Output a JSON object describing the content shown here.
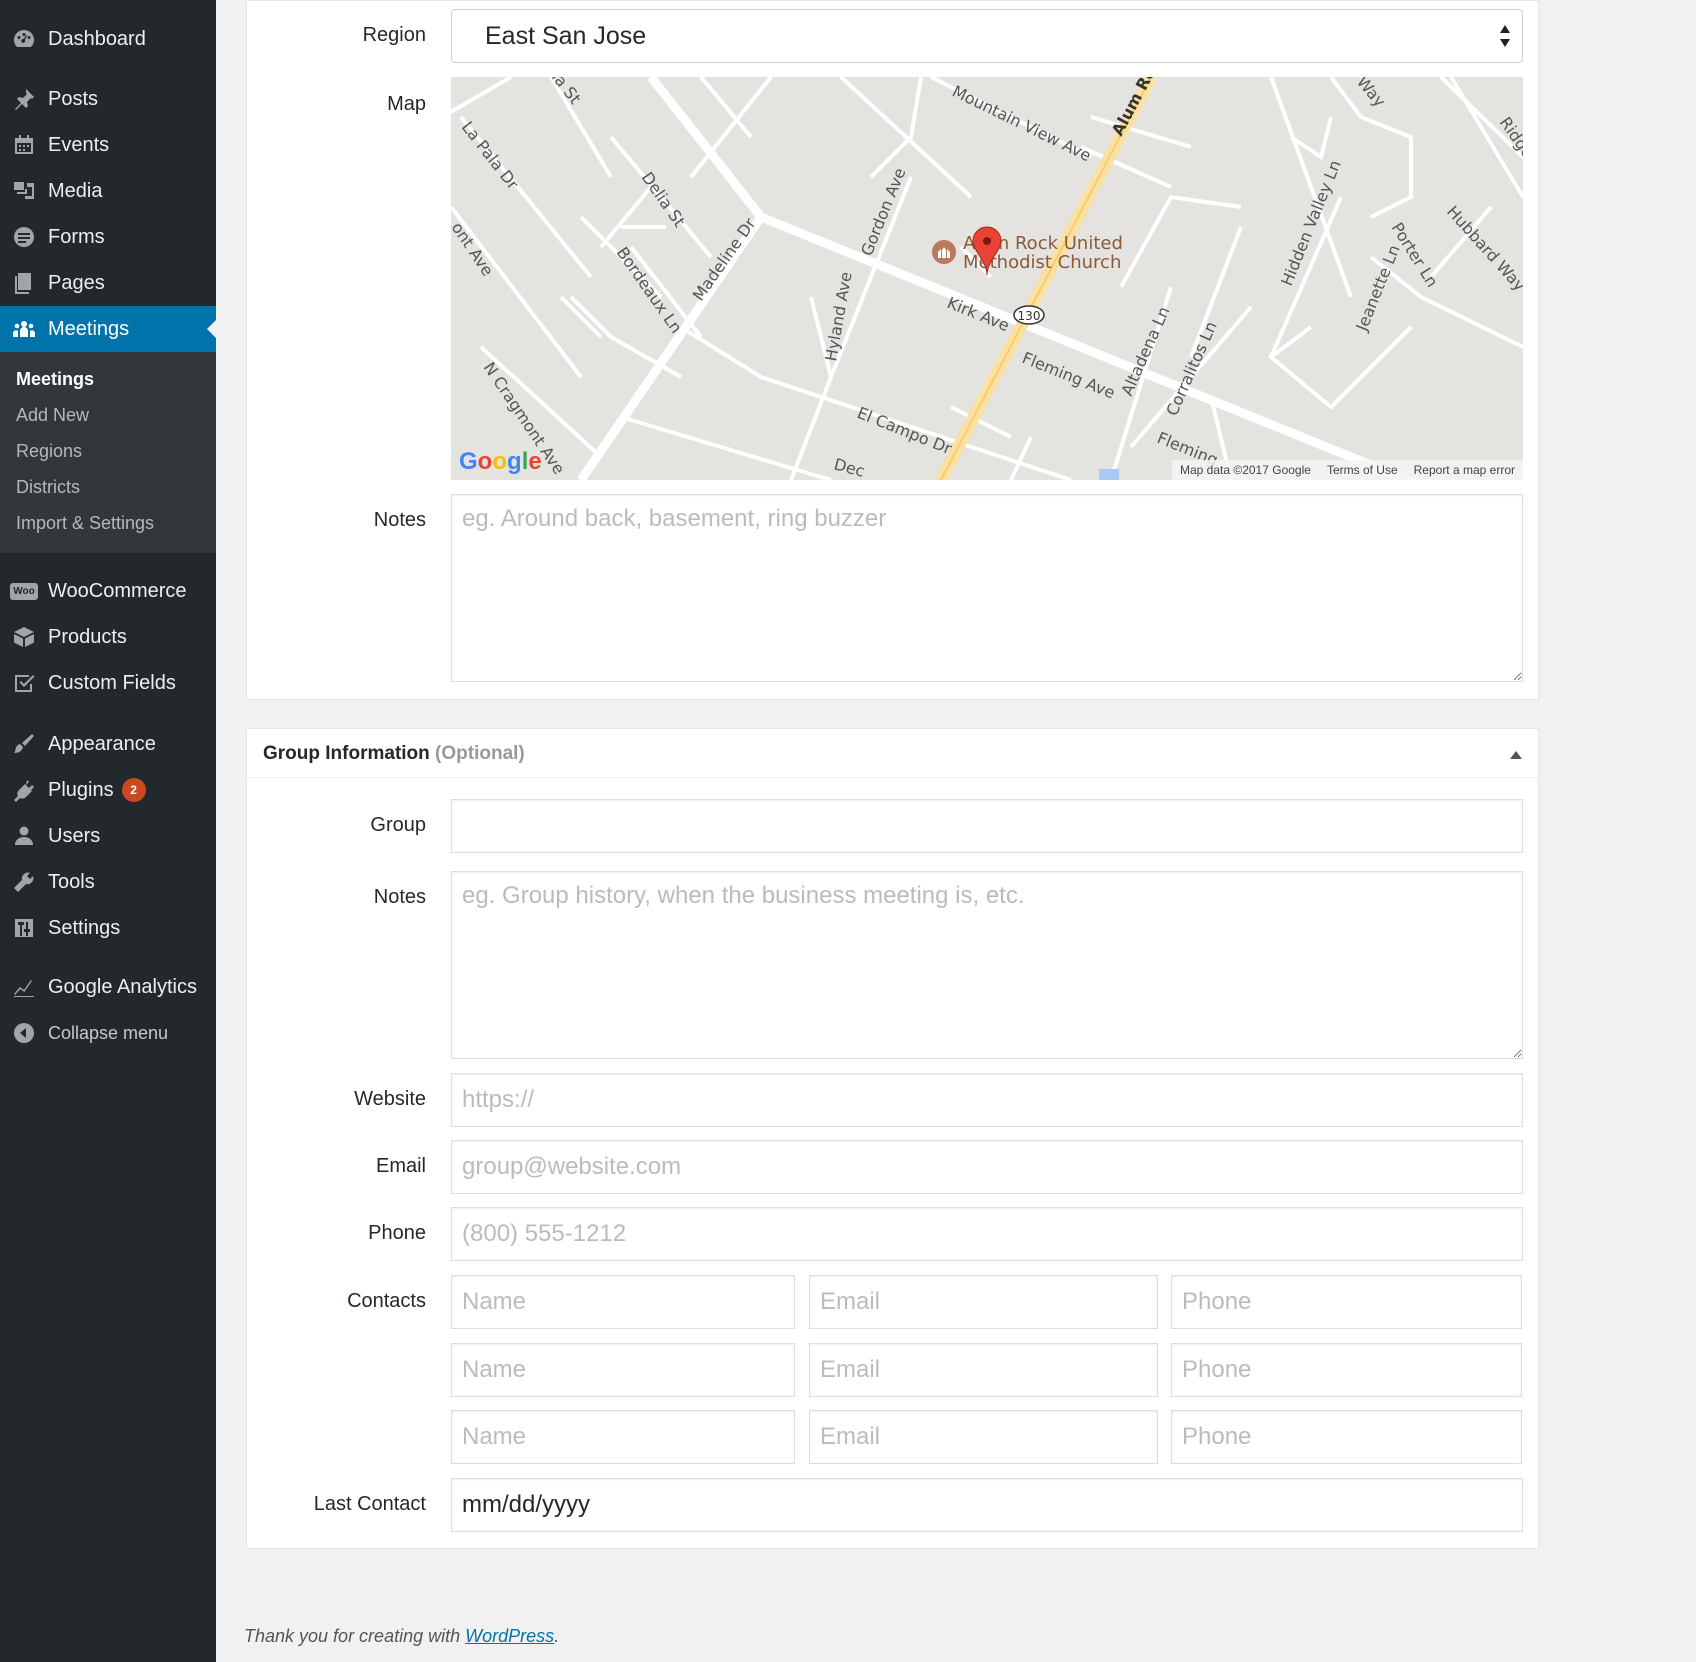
{
  "sidebar": {
    "items": [
      {
        "label": "Dashboard",
        "icon": "dashboard-icon"
      },
      {
        "label": "Posts",
        "icon": "pin-icon"
      },
      {
        "label": "Events",
        "icon": "calendar-icon"
      },
      {
        "label": "Media",
        "icon": "media-icon"
      },
      {
        "label": "Forms",
        "icon": "forms-icon"
      },
      {
        "label": "Pages",
        "icon": "pages-icon"
      },
      {
        "label": "Meetings",
        "icon": "groups-icon"
      },
      {
        "label": "WooCommerce",
        "icon": "woo-icon",
        "icon_text": "Woo"
      },
      {
        "label": "Products",
        "icon": "box-icon"
      },
      {
        "label": "Custom Fields",
        "icon": "checkbox-icon"
      },
      {
        "label": "Appearance",
        "icon": "brush-icon"
      },
      {
        "label": "Plugins",
        "icon": "plug-icon",
        "badge": "2"
      },
      {
        "label": "Users",
        "icon": "user-icon"
      },
      {
        "label": "Tools",
        "icon": "wrench-icon"
      },
      {
        "label": "Settings",
        "icon": "settings-icon"
      },
      {
        "label": "Google Analytics",
        "icon": "chart-line-icon"
      },
      {
        "label": "Collapse menu",
        "icon": "collapse-icon"
      }
    ],
    "submenu": [
      "Meetings",
      "Add New",
      "Regions",
      "Districts",
      "Import & Settings"
    ],
    "accent": "#0073aa"
  },
  "location": {
    "region_label": "Region",
    "region_value": "East San Jose",
    "map_label": "Map",
    "notes_label": "Notes",
    "notes_placeholder": "eg. Around back, basement, ring buzzer"
  },
  "map": {
    "streets": [
      "La Pala Dr",
      "Delia St",
      "Bordeaux Ln",
      "Madeline Dr",
      "Gordon Ave",
      "Hyland Ave",
      "Mountain View Ave",
      "Alum Rock",
      "Kirk Ave",
      "Fleming Ave",
      "El Campo Dr",
      "N Cragmont Ave",
      "ont Ave",
      "Altadena Ln",
      "Corralitos Ln",
      "Hidden Valley Ln",
      "Porter Ln",
      "Jeanette Ln",
      "Hubbard Way",
      "Ridge",
      "Way",
      "ia St",
      "Dec",
      "Fleming"
    ],
    "route_number": "130",
    "place_name": "Alum Rock United Methodist Church",
    "logo": "Google",
    "attribution": [
      "Map data ©2017 Google",
      "Terms of Use",
      "Report a map error"
    ]
  },
  "group": {
    "title": "Group Information",
    "optional": "(Optional)",
    "group_label": "Group",
    "group_value": "",
    "notes_label": "Notes",
    "notes_placeholder": "eg. Group history, when the business meeting is, etc.",
    "website_label": "Website",
    "website_placeholder": "https://",
    "email_label": "Email",
    "email_placeholder": "group@website.com",
    "phone_label": "Phone",
    "phone_placeholder": "(800) 555-1212",
    "contacts_label": "Contacts",
    "contacts": [
      {
        "name": "Name",
        "email": "Email",
        "phone": "Phone"
      },
      {
        "name": "Name",
        "email": "Email",
        "phone": "Phone"
      },
      {
        "name": "Name",
        "email": "Email",
        "phone": "Phone"
      }
    ],
    "last_contact_label": "Last Contact",
    "last_contact_value": "mm/dd/yyyy"
  },
  "footer": {
    "text": "Thank you for creating with",
    "link": "WordPress",
    "end": "."
  }
}
